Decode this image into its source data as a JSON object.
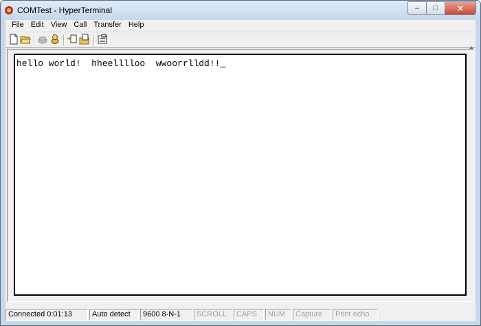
{
  "window": {
    "title": "COMTest - HyperTerminal"
  },
  "window_buttons": {
    "minimize": "–",
    "maximize": "□",
    "close": "✕"
  },
  "menu": [
    "File",
    "Edit",
    "View",
    "Call",
    "Transfer",
    "Help"
  ],
  "toolbar": {
    "icons": [
      "new-connection-icon",
      "open-icon",
      "disconnect-icon",
      "dial-icon",
      "send-icon",
      "receive-icon",
      "properties-icon"
    ]
  },
  "terminal": {
    "text": "hello world!  hheelllloo  wwoorrlldd!!",
    "cursor": "_"
  },
  "status": {
    "connected": "Connected 0:01:13",
    "detect": "Auto detect",
    "settings": "9600 8-N-1",
    "scroll": "SCROLL",
    "caps": "CAPS",
    "num": "NUM",
    "capture": "Capture",
    "print_echo": "Print echo"
  }
}
